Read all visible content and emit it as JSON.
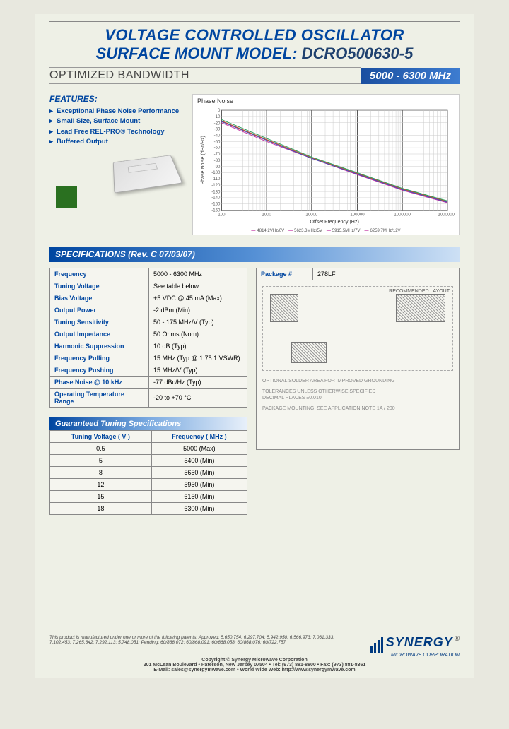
{
  "title": {
    "line1": "VOLTAGE CONTROLLED OSCILLATOR",
    "line2_prefix": "SURFACE MOUNT MODEL: ",
    "model": "DCRO500630-5"
  },
  "optimized_bw": "OPTIMIZED BANDWIDTH",
  "freq_band": "5000 - 6300 MHz",
  "features": {
    "heading": "FEATURES:",
    "items": [
      "Exceptional Phase Noise Performance",
      "Small Size, Surface Mount",
      "Lead Free REL-PRO® Technology",
      "Buffered Output"
    ]
  },
  "chart": {
    "title": "Phase Noise",
    "xlabel": "Offset Frequency (Hz)",
    "ylabel": "Phase Noise (dBc/Hz)",
    "legend": [
      "4814.2VHz/0V",
      "5623.3MHz/5V",
      "5915.5MHz/7V",
      "6259.7MHz/12V"
    ]
  },
  "chart_data": {
    "type": "line",
    "title": "Phase Noise",
    "xlabel": "Offset Frequency (Hz)",
    "ylabel": "Phase Noise (dBc/Hz)",
    "x_scale": "log",
    "xlim": [
      100,
      10000000
    ],
    "ylim": [
      -160,
      0
    ],
    "series": [
      {
        "name": "4814.2VHz/0V",
        "x": [
          100,
          1000,
          10000,
          100000,
          1000000,
          10000000
        ],
        "y": [
          -20,
          -50,
          -77,
          -103,
          -128,
          -148
        ]
      },
      {
        "name": "5623.3MHz/5V",
        "x": [
          100,
          1000,
          10000,
          100000,
          1000000,
          10000000
        ],
        "y": [
          -18,
          -48,
          -77,
          -102,
          -127,
          -147
        ]
      },
      {
        "name": "5915.5MHz/7V",
        "x": [
          100,
          1000,
          10000,
          100000,
          1000000,
          10000000
        ],
        "y": [
          -17,
          -47,
          -76,
          -101,
          -126,
          -146
        ]
      },
      {
        "name": "6259.7MHz/12V",
        "x": [
          100,
          1000,
          10000,
          100000,
          1000000,
          10000000
        ],
        "y": [
          -15,
          -45,
          -75,
          -100,
          -125,
          -145
        ]
      }
    ]
  },
  "spec_header": "SPECIFICATIONS (Rev. C 07/03/07)",
  "specs": [
    {
      "k": "Frequency",
      "v": "5000 - 6300 MHz"
    },
    {
      "k": "Tuning Voltage",
      "v": "See table below"
    },
    {
      "k": "Bias Voltage",
      "v": "+5 VDC @ 45 mA (Max)"
    },
    {
      "k": "Output Power",
      "v": "-2 dBm (Min)"
    },
    {
      "k": "Tuning Sensitivity",
      "v": "50 - 175 MHz/V (Typ)"
    },
    {
      "k": "Output Impedance",
      "v": "50 Ohms (Nom)"
    },
    {
      "k": "Harmonic Suppression",
      "v": "10 dB (Typ)"
    },
    {
      "k": "Frequency Pulling",
      "v": "15 MHz (Typ @ 1.75:1 VSWR)"
    },
    {
      "k": "Frequency Pushing",
      "v": "15 MHz/V (Typ)"
    },
    {
      "k": "Phase Noise @ 10 kHz",
      "v": "-77 dBc/Hz (Typ)"
    },
    {
      "k": "Operating Temperature Range",
      "v": "-20 to +70 °C"
    }
  ],
  "package": {
    "label": "Package #",
    "value": "278LF"
  },
  "pkg_notes": {
    "rec_layout": "RECOMMENDED LAYOUT",
    "opt_solder": "OPTIONAL SOLDER AREA FOR IMPROVED GROUNDING",
    "tol": "TOLERANCES UNLESS OTHERWISE SPECIFIED",
    "dec": "DECIMAL PLACES ±0.010",
    "mount": "PACKAGE MOUNTING: SEE APPLICATION NOTE 1A / 200"
  },
  "tune_header": "Guaranteed Tuning Specifications",
  "tune_cols": {
    "v": "Tuning Voltage ( V )",
    "f": "Frequency ( MHz )"
  },
  "tune_rows": [
    {
      "v": "0.5",
      "f": "5000 (Max)"
    },
    {
      "v": "5",
      "f": "5400 (Min)"
    },
    {
      "v": "8",
      "f": "5650 (Min)"
    },
    {
      "v": "12",
      "f": "5950 (Min)"
    },
    {
      "v": "15",
      "f": "6150 (Min)"
    },
    {
      "v": "18",
      "f": "6300 (Min)"
    }
  ],
  "footer": {
    "patents": "This product is manufactured under one or more of the following patents: Approved: 5,650,754; 6,297,704; 5,942,950; 6,566,973; 7,061,333; 7,102,453; 7,265,642; 7,292,113; 5,748,051; Pending: 60/868,072; 60/868,091; 60/868,058; 60/868,076; 60/722,757",
    "copyright": "Copyright © Synergy Microwave Corporation",
    "addr": "201 McLean Boulevard • Paterson, New Jersey 07504 • Tel: (973) 881-8800 • Fax: (973) 881-8361",
    "contact": "E-Mail: sales@synergymwave.com • World Wide Web: http://www.synergymwave.com",
    "logo": "SYNERGY",
    "logo_sub": "MICROWAVE CORPORATION"
  }
}
